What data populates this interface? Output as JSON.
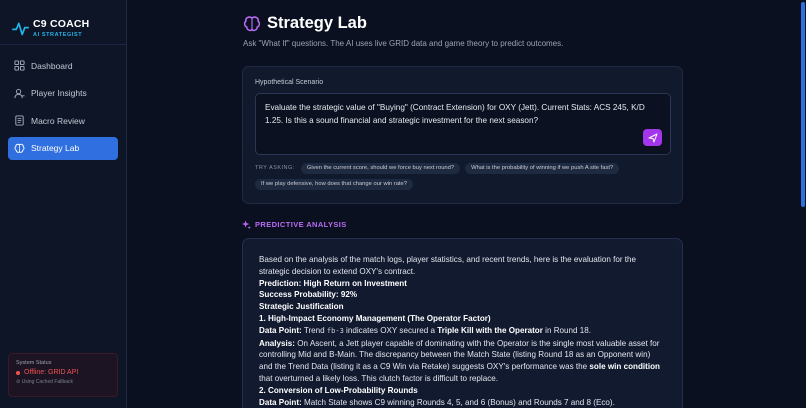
{
  "brand": {
    "title": "C9 COACH",
    "subtitle": "AI STRATEGIST",
    "accent": "#22b4e8"
  },
  "sidebar": {
    "items": [
      {
        "label": "Dashboard",
        "icon": "dashboard-grid-icon",
        "active": false
      },
      {
        "label": "Player Insights",
        "icon": "user-icon",
        "active": false
      },
      {
        "label": "Macro Review",
        "icon": "document-icon",
        "active": false
      },
      {
        "label": "Strategy Lab",
        "icon": "brain-icon",
        "active": true
      }
    ],
    "active_color": "#2f6fe0"
  },
  "system_status": {
    "title": "System Status",
    "state": "Offline: GRID API",
    "note": "Using Cached Fallback",
    "color": "#f05252"
  },
  "page": {
    "title": "Strategy Lab",
    "subtitle": "Ask \"What If\" questions. The AI uses live GRID data and game theory to predict outcomes."
  },
  "scenario": {
    "label": "Hypothetical Scenario",
    "value": "Evaluate the strategic value of \"Buying\" (Contract Extension) for OXY (Jett). Current Stats: ACS 245, K/D 1.25. Is this a sound financial and strategic investment for the next season?",
    "send_icon": "send-icon",
    "send_color": "#a335ea"
  },
  "try_asking": {
    "label": "TRY ASKING:",
    "chips": [
      "Given the current score, should we force buy next round?",
      "What is the probability of winning if we push A site fast?",
      "If we play defensive, how does that change our win rate?"
    ]
  },
  "analysis": {
    "heading": "PREDICTIVE ANALYSIS",
    "heading_color": "#b86cf2",
    "intro": "Based on the analysis of the match logs, player statistics, and recent trends, here is the evaluation for the strategic decision to extend OXY's contract.",
    "prediction": "Prediction: High Return on Investment",
    "probability": "Success Probability: 92%",
    "justification": "Strategic Justification",
    "point1_title": "1. High-Impact Economy Management (The Operator Factor)",
    "dp_label": "Data Point:",
    "dp1_a": " Trend ",
    "dp1_code": "fb-3",
    "dp1_b": " indicates OXY secured a ",
    "dp1_bold": "Triple Kill with the Operator",
    "dp1_c": " in Round 18.",
    "analysis_label": "Analysis:",
    "analysis1_a": " On Ascent, a Jett player capable of dominating with the Operator is the single most valuable asset for controlling Mid and B-Main. The discrepancy between the Match State (listing Round 18 as an Opponent win) and the Trend Data (listing it as a C9 Win via Retake) suggests OXY's performance was the ",
    "analysis1_bold": "sole win condition",
    "analysis1_b": " that overturned a likely loss. This clutch factor is difficult to replace.",
    "point2_title": "2. Conversion of Low-Probability Rounds",
    "dp2_text": " Match State shows C9 winning Rounds 4, 5, and 6 (Bonus) and Rounds 7 and 8 (Eco)."
  }
}
